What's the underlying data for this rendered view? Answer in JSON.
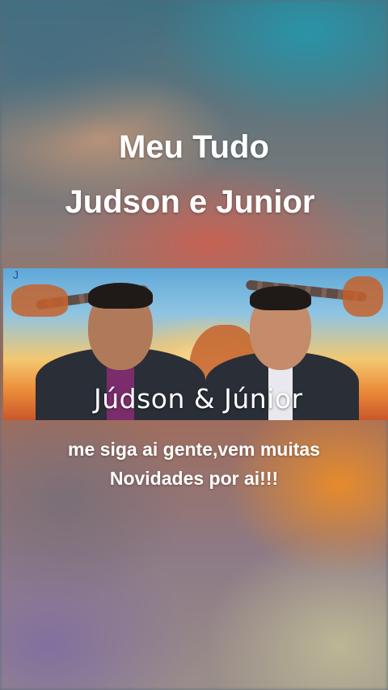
{
  "title_line1": "Meu Tudo",
  "title_line2": "Judson e Junior",
  "banner": {
    "logo_text": "Júdson & Júnior",
    "corner_mark": "J"
  },
  "caption": "me siga ai gente,vem muitas Novidades por ai!!!",
  "colors": {
    "text": "#ffffff",
    "sky": "#5fa8d8",
    "sunset": "#ec8d3a"
  }
}
